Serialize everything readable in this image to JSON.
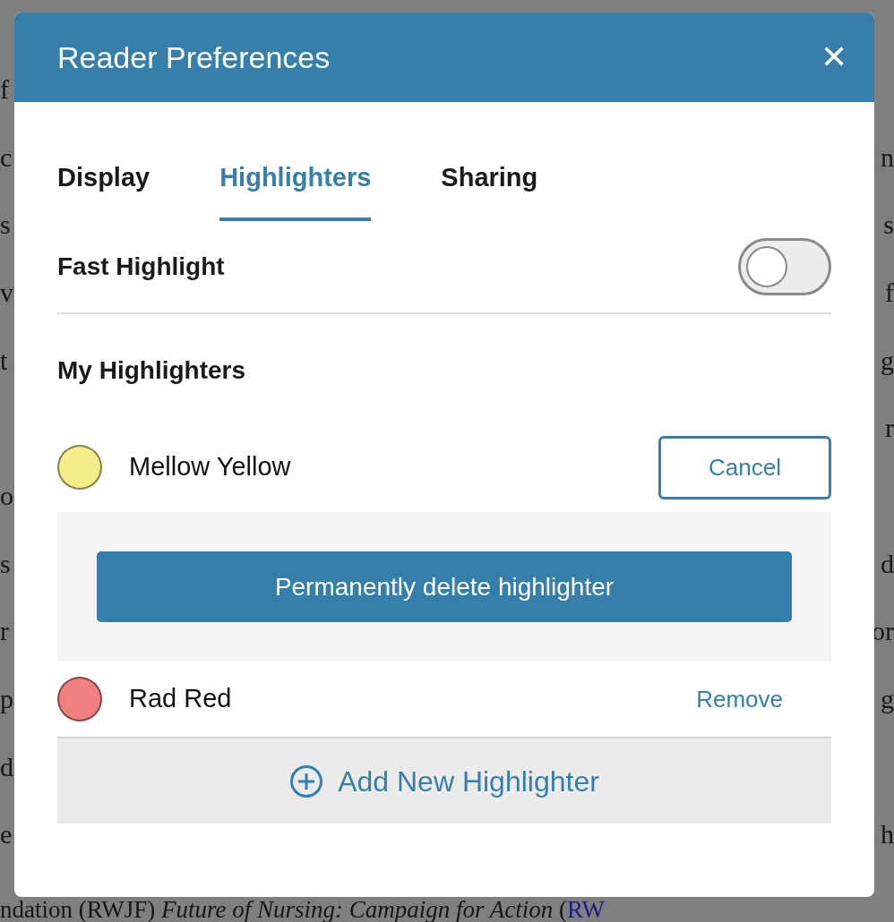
{
  "background_text": {
    "lines": [
      {
        "left": "f"
      },
      {
        "left": "c",
        "right": "n"
      },
      {
        "left": "s",
        "right": "s"
      },
      {
        "left": "v",
        "right": "f"
      },
      {
        "left": "t",
        "right": "g"
      },
      {
        "right": "r"
      },
      {
        "left": "o"
      },
      {
        "left": "s",
        "right": "d"
      },
      {
        "left": "r",
        "right": "or"
      },
      {
        "left": "p",
        "right": "g"
      },
      {
        "left": "d"
      },
      {
        "left": "e",
        "right": "h"
      }
    ],
    "last_line": {
      "text": "ndation (RWJF) *Future of Nursing: Campaign for Action* (",
      "link": "RW"
    }
  },
  "dialog": {
    "title": "Reader Preferences",
    "close": "✕",
    "tabs": [
      {
        "label": "Display",
        "selected": false
      },
      {
        "label": "Highlighters",
        "selected": true
      },
      {
        "label": "Sharing",
        "selected": false
      }
    ],
    "fast_highlight": {
      "label": "Fast Highlight",
      "on": false
    },
    "section_title": "My Highlighters",
    "highlighters": [
      {
        "name": "Mellow Yellow",
        "color": "#f5ec8a",
        "confirm_delete": true,
        "action": "Cancel",
        "delete_label": "Permanently delete highlighter"
      },
      {
        "name": "Rad Red",
        "color": "#f08080",
        "confirm_delete": false,
        "action": "Remove"
      }
    ],
    "add_button": "Add New Highlighter"
  }
}
